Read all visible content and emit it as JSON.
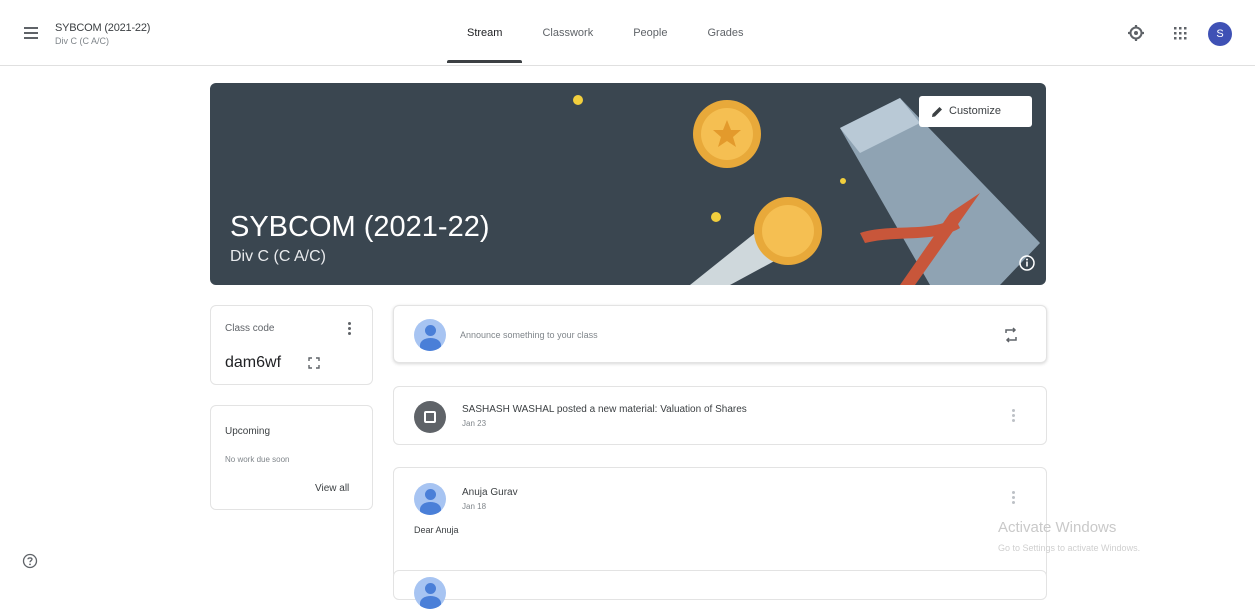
{
  "header": {
    "class_title": "SYBCOM (2021-22)",
    "class_section": "Div C (C A/C)",
    "tabs": [
      {
        "label": "Stream"
      },
      {
        "label": "Classwork"
      },
      {
        "label": "People"
      },
      {
        "label": "Grades"
      }
    ],
    "avatar_initial": "S",
    "icons": [
      "menu-icon",
      "settings-icon",
      "apps-grid-icon"
    ]
  },
  "banner": {
    "title": "SYBCOM (2021-22)",
    "subtitle": "Div C (C A/C)",
    "customize_label": "Customize",
    "background_color": "#3a4650"
  },
  "class_code": {
    "label": "Class code",
    "value": "dam6wf"
  },
  "upcoming": {
    "title": "Upcoming",
    "empty_text": "No work due soon",
    "view_all_label": "View all"
  },
  "stream": {
    "announce_placeholder": "Announce something to your class",
    "posts": [
      {
        "title": "SASHASH WASHAL posted a new material: Valuation of Shares",
        "date": "Jan 23"
      },
      {
        "author": "Anuja Gurav",
        "date": "Jan 18",
        "body": "Dear Anuja"
      }
    ]
  },
  "watermark": {
    "title": "Activate Windows",
    "subtitle": "Go to Settings to activate Windows."
  },
  "colors": {
    "accent": "#3f51b5",
    "avatar_blue": "#4a7fd8",
    "banner_dark": "#3a4650",
    "gold": "#e8a93a"
  }
}
